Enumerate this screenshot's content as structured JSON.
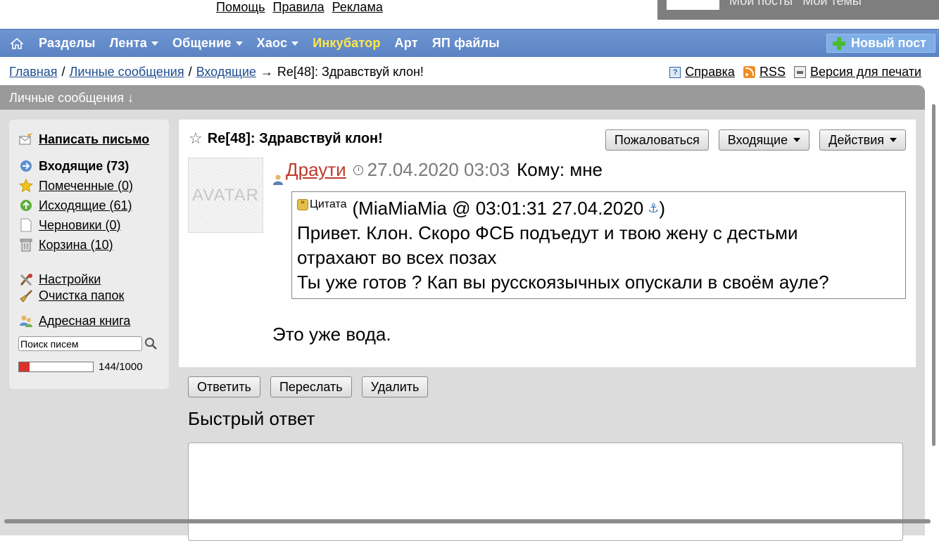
{
  "top": {
    "links": [
      "Помощь",
      "Правила",
      "Реклама"
    ],
    "right_links": [
      "Мои посты",
      "Мои темы"
    ]
  },
  "nav": {
    "items": [
      {
        "label": "Разделы",
        "dropdown": false
      },
      {
        "label": "Лента",
        "dropdown": true
      },
      {
        "label": "Общение",
        "dropdown": true
      },
      {
        "label": "Хаос",
        "dropdown": true
      },
      {
        "label": "Инкубатор",
        "dropdown": false,
        "highlight": "#ffe84a"
      },
      {
        "label": "Арт",
        "dropdown": false
      },
      {
        "label": "ЯП файлы",
        "dropdown": false
      }
    ],
    "new_post": "Новый пост"
  },
  "breadcrumb": {
    "home": "Главная",
    "sep": "/",
    "pm": "Личные сообщения",
    "inbox": "Входящие",
    "arrow": "→",
    "current": "Re[48]: Здравствуй клон!"
  },
  "utility": {
    "help": "Справка",
    "rss": "RSS",
    "print": "Версия для печати"
  },
  "section": {
    "title": "Личные сообщения ↓"
  },
  "sidebar": {
    "compose": "Написать письмо",
    "folders": [
      {
        "label": "Входящие (73)",
        "icon": "inbox-icon",
        "bold": true
      },
      {
        "label": "Помеченные (0)",
        "icon": "star-icon"
      },
      {
        "label": "Исходящие (61)",
        "icon": "outbox-icon"
      },
      {
        "label": "Черновики (0)",
        "icon": "draft-icon"
      },
      {
        "label": "Корзина (10)",
        "icon": "trash-icon"
      }
    ],
    "settings": "Настройки",
    "cleanup": "Очистка папок",
    "addressbook": "Адресная книга",
    "search_placeholder": "Поиск писем",
    "quota": {
      "used": 144,
      "total": 1000,
      "text": "144/1000"
    }
  },
  "message": {
    "subject": "Re[48]: Здравствуй клон!",
    "buttons": {
      "report": "Пожаловаться",
      "inbox": "Входящие",
      "actions": "Действия"
    },
    "avatar_text": "AVATAR",
    "author": "Драути",
    "date": "27.04.2020 03:03",
    "to": "Кому: мне",
    "quote": {
      "label": "Цитата",
      "source": "(MiaMiaMia @ 03:01:31 27.04.2020 ",
      "source_end": ")",
      "lines": [
        "Привет. Клон. Скоро ФСБ подъедут и твою жену с дестьми",
        "отрахают во всех позах",
        "Ты уже готов ? Кап вы русскоязычных опускали в своём ауле?"
      ]
    },
    "body": "Это уже вода."
  },
  "actions": {
    "reply": "Ответить",
    "forward": "Переслать",
    "delete": "Удалить"
  },
  "quick_reply": {
    "title": "Быстрый ответ"
  }
}
